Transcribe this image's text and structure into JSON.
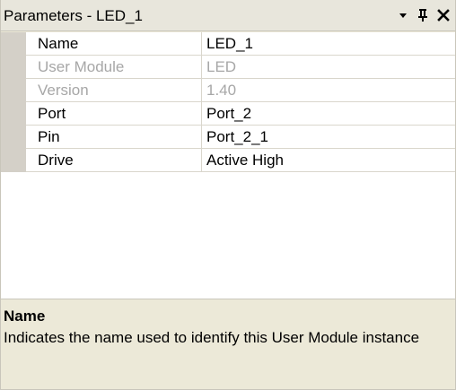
{
  "window": {
    "title": "Parameters - LED_1",
    "buttons": {
      "dropdown_icon": "chevron-down-icon",
      "pin_icon": "pin-icon",
      "close_icon": "close-icon"
    }
  },
  "parameters": [
    {
      "name": "Name",
      "value": "LED_1",
      "enabled": true
    },
    {
      "name": "User Module",
      "value": "LED",
      "enabled": false
    },
    {
      "name": "Version",
      "value": "1.40",
      "enabled": false
    },
    {
      "name": "Port",
      "value": "Port_2",
      "enabled": true
    },
    {
      "name": "Pin",
      "value": "Port_2_1",
      "enabled": true
    },
    {
      "name": "Drive",
      "value": "Active High",
      "enabled": true
    }
  ],
  "description": {
    "title": "Name",
    "body": "Indicates the name used to identify this User Module instance"
  },
  "colors": {
    "panel_bg": "#ece9d8",
    "gutter": "#d4d0c8",
    "disabled_text": "#a7a7a7"
  }
}
